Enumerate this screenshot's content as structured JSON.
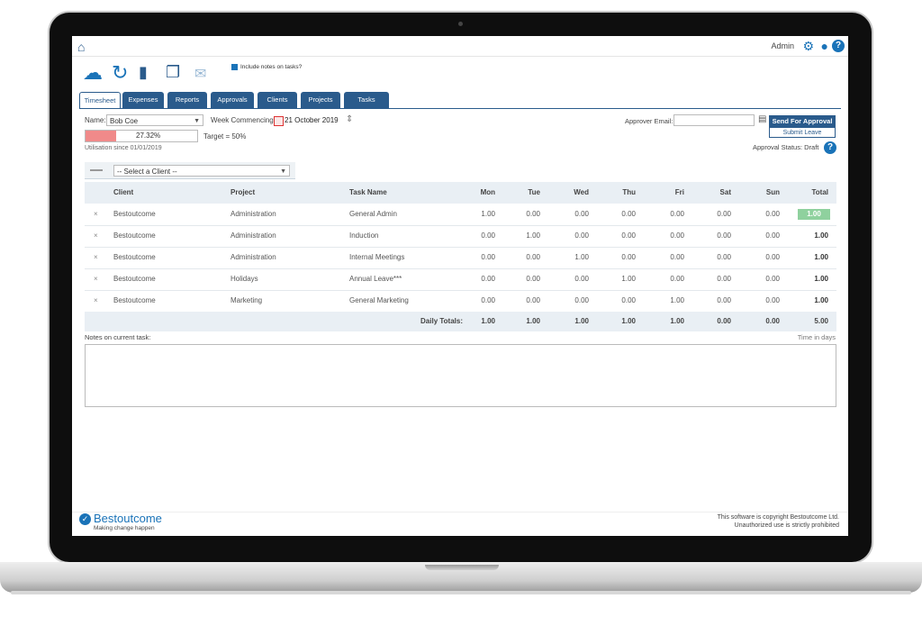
{
  "topbar": {
    "admin_label": "Admin",
    "help_symbol": "?"
  },
  "toolbar": {
    "icons": [
      "upload-cloud-icon",
      "refresh-icon",
      "eraser-icon",
      "copy-icon",
      "mail-icon"
    ],
    "include_notes_label": "Include notes on tasks?"
  },
  "tabs": [
    "Timesheet",
    "Expenses",
    "Reports",
    "Approvals",
    "Clients",
    "Projects",
    "Tasks"
  ],
  "form": {
    "name_label": "Name:",
    "name_value": "Bob Coe",
    "week_label": "Week Commencing",
    "week_value": "21 October 2019",
    "utilisation_value": "27.32%",
    "utilisation_percent": 27.32,
    "target_label": "Target = 50%",
    "utilisation_since": "Utilisation since 01/01/2019",
    "approver_label": "Approver Email:",
    "send_button": "Send For Approval",
    "submit_leave_button": "Submit Leave",
    "approval_status": "Approval Status: Draft",
    "client_select": "-- Select a Client --"
  },
  "table": {
    "headers": [
      "Client",
      "Project",
      "Task Name",
      "Mon",
      "Tue",
      "Wed",
      "Thu",
      "Fri",
      "Sat",
      "Sun",
      "Total"
    ],
    "rows": [
      {
        "remove": "×",
        "client": "Bestoutcome",
        "project": "Administration",
        "task": "General Admin",
        "days": [
          "1.00",
          "0.00",
          "0.00",
          "0.00",
          "0.00",
          "0.00",
          "0.00"
        ],
        "total": "1.00"
      },
      {
        "remove": "×",
        "client": "Bestoutcome",
        "project": "Administration",
        "task": "Induction",
        "days": [
          "0.00",
          "1.00",
          "0.00",
          "0.00",
          "0.00",
          "0.00",
          "0.00"
        ],
        "total": "1.00"
      },
      {
        "remove": "×",
        "client": "Bestoutcome",
        "project": "Administration",
        "task": "Internal Meetings",
        "days": [
          "0.00",
          "0.00",
          "1.00",
          "0.00",
          "0.00",
          "0.00",
          "0.00"
        ],
        "total": "1.00"
      },
      {
        "remove": "×",
        "client": "Bestoutcome",
        "project": "Holidays",
        "task": "Annual Leave***",
        "days": [
          "0.00",
          "0.00",
          "0.00",
          "1.00",
          "0.00",
          "0.00",
          "0.00"
        ],
        "total": "1.00"
      },
      {
        "remove": "×",
        "client": "Bestoutcome",
        "project": "Marketing",
        "task": "General Marketing",
        "days": [
          "0.00",
          "0.00",
          "0.00",
          "0.00",
          "1.00",
          "0.00",
          "0.00"
        ],
        "total": "1.00"
      }
    ],
    "daily_totals_label": "Daily Totals:",
    "daily_totals": [
      "1.00",
      "1.00",
      "1.00",
      "1.00",
      "1.00",
      "0.00",
      "0.00",
      "5.00"
    ]
  },
  "notes": {
    "label": "Notes on current task:",
    "units": "Time in days"
  },
  "footer": {
    "brand": "Bestoutcome",
    "tagline": "Making change happen",
    "copyright_1": "This software is copyright Bestoutcome Ltd.",
    "copyright_2": "Unauthorized use is strictly prohibited"
  },
  "colors": {
    "brand_blue": "#2a5b8c",
    "accent_blue": "#1a73b8",
    "utilisation_red": "#f08a8a",
    "total_green": "#8fd19e"
  }
}
